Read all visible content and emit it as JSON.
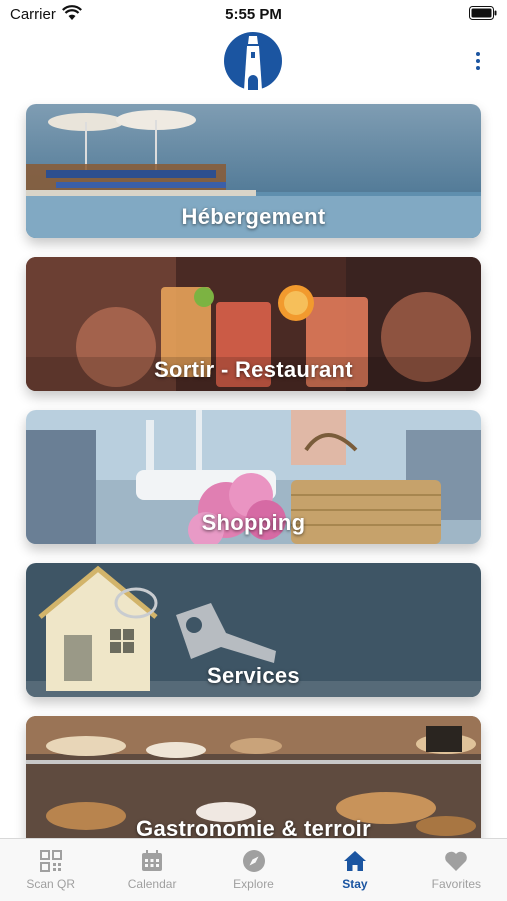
{
  "status": {
    "carrier": "Carrier",
    "time": "5:55 PM"
  },
  "accent_color": "#1b55a1",
  "header": {
    "logo": "lighthouse-logo",
    "menu_icon": "more-vertical-icon"
  },
  "cards": [
    {
      "label": "Hébergement",
      "image": "beach-loungers-photo"
    },
    {
      "label": "Sortir - Restaurant",
      "image": "cocktails-toast-photo"
    },
    {
      "label": "Shopping",
      "image": "basket-flowers-marina-photo"
    },
    {
      "label": "Services",
      "image": "house-keychain-photo"
    },
    {
      "label": "Gastronomie & terroir",
      "image": "bakery-display-photo"
    }
  ],
  "tabs": [
    {
      "label": "Scan QR",
      "icon": "qr-code-icon",
      "active": false
    },
    {
      "label": "Calendar",
      "icon": "calendar-icon",
      "active": false
    },
    {
      "label": "Explore",
      "icon": "compass-icon",
      "active": false
    },
    {
      "label": "Stay",
      "icon": "home-icon",
      "active": true
    },
    {
      "label": "Favorites",
      "icon": "heart-icon",
      "active": false
    }
  ]
}
